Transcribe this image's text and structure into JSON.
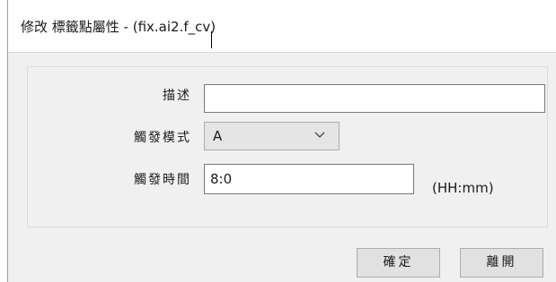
{
  "window": {
    "title": "修改 標籤點屬性 - (fix.ai2.f_cv)"
  },
  "form": {
    "description": {
      "label": "描述",
      "value": ""
    },
    "trigger_mode": {
      "label": "觸發模式",
      "selected": "A"
    },
    "trigger_time": {
      "label": "觸發時間",
      "value": "8:0",
      "unit": "(HH:mm)"
    }
  },
  "buttons": {
    "ok": "確定",
    "close": "離開"
  },
  "icons": {
    "select_arrow": "chevron-down-icon"
  }
}
